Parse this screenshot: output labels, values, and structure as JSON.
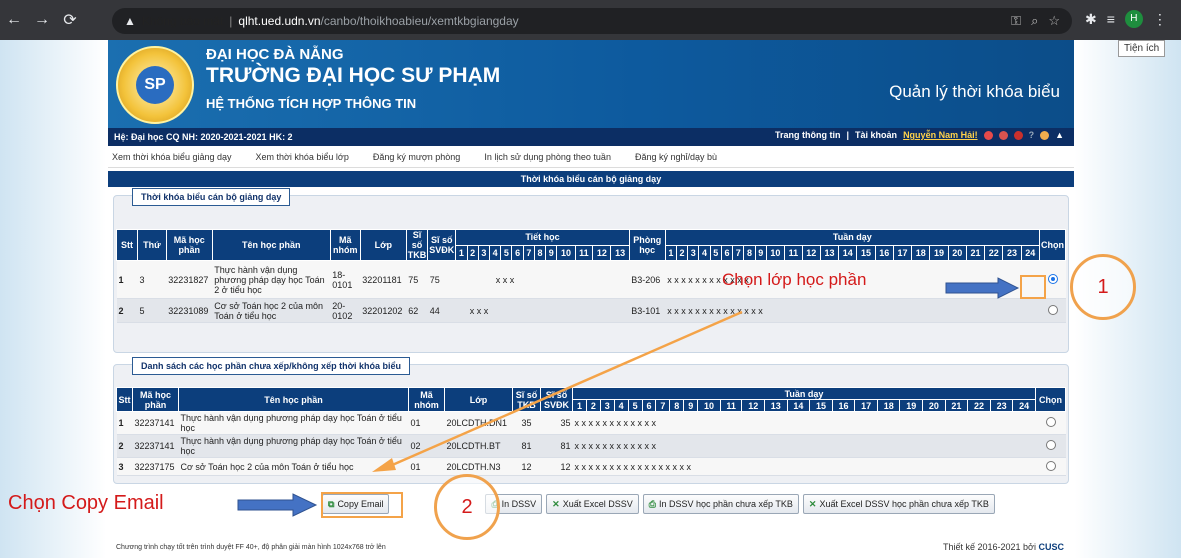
{
  "browser": {
    "security_label": "Không bảo mật",
    "url_host": "qlht.ued.udn.vn",
    "url_path": "/canbo/thoikhoabieu/xemtkbgiangday",
    "avatar_letter": "H",
    "tooltip": "Tiện ích"
  },
  "header": {
    "line1": "ĐẠI HỌC ĐÀ NẴNG",
    "line2": "TRƯỜNG ĐẠI HỌC SƯ PHẠM",
    "line3": "HỆ THỐNG TÍCH HỢP THÔNG TIN",
    "app_title": "Quản lý thời khóa biểu"
  },
  "status": {
    "left": "Hệ: Đại học CQ  NH: 2020-2021-2021  HK: 2",
    "info_link": "Trang thông tin",
    "account_label": "Tài khoản",
    "account_name": "Nguyễn Nam Hải!"
  },
  "menu": [
    "Xem thời khóa biểu giảng dạy",
    "Xem thời khóa biểu lớp",
    "Đăng ký mượn phòng",
    "In lịch sử dụng phòng theo tuần",
    "Đăng ký nghỉ/dạy bù"
  ],
  "section_title": "Thời khóa biểu cán bộ giảng dạy",
  "panel1": {
    "title": "Thời khóa biểu cán bộ giảng dạy",
    "headers": {
      "stt": "Stt",
      "thu": "Thứ",
      "ma_hp": "Mã học phần",
      "ten_hp": "Tên học phần",
      "ma_nhom": "Mã nhóm",
      "lop": "Lớp",
      "si_so_tkb": "Sĩ số TKB",
      "si_so_svdk": "Sĩ số SVĐK",
      "tiet_hoc": "Tiết học",
      "phong": "Phòng học",
      "tuan_day": "Tuần dạy",
      "chon": "Chọn"
    },
    "tiet": [
      "1",
      "2",
      "3",
      "4",
      "5",
      "6",
      "7",
      "8",
      "9",
      "10",
      "11",
      "12",
      "13"
    ],
    "tuan": [
      "1",
      "2",
      "3",
      "4",
      "5",
      "6",
      "7",
      "8",
      "9",
      "10",
      "11",
      "12",
      "13",
      "14",
      "15",
      "16",
      "17",
      "18",
      "19",
      "20",
      "21",
      "22",
      "23",
      "24"
    ],
    "rows": [
      {
        "stt": "1",
        "thu": "3",
        "ma": "32231827",
        "ten": "Thực hành vận dụng phương pháp dạy học Toán 2 ở tiểu học",
        "nhom": "18-0101",
        "lop": "32201181",
        "tkb": "75",
        "svdk": "75",
        "tiet": "x x x",
        "phong": "B3-206",
        "tuan": "x x x x x x x x x x x x",
        "selected": true
      },
      {
        "stt": "2",
        "thu": "5",
        "ma": "32231089",
        "ten": "Cơ sở Toán học 2 của môn Toán ở tiểu học",
        "nhom": "20-0102",
        "lop": "32201202",
        "tkb": "62",
        "svdk": "44",
        "tiet": "x x x",
        "phong": "B3-101",
        "tuan": "x x x x x x x x x x x x x x",
        "selected": false
      }
    ]
  },
  "panel2": {
    "title": "Danh sách các học phần chưa xếp/không xếp thời khóa biểu",
    "headers": {
      "stt": "Stt",
      "ma_hp": "Mã học phần",
      "ten_hp": "Tên học phần",
      "ma_nhom": "Mã nhóm",
      "lop": "Lớp",
      "si_so_tkb": "Sĩ số TKB",
      "si_so_svdk": "Sĩ số SVĐK",
      "tuan_day": "Tuần dạy",
      "chon": "Chọn"
    },
    "rows": [
      {
        "stt": "1",
        "ma": "32237141",
        "ten": "Thực hành vận dụng phương pháp dạy học Toán ở tiểu học",
        "nhom": "01",
        "lop": "20LCDTH.DN1",
        "tkb": "35",
        "svdk": "35",
        "tuan": "x x x x x x x x x x x x"
      },
      {
        "stt": "2",
        "ma": "32237141",
        "ten": "Thực hành vận dụng phương pháp dạy học Toán ở tiểu học",
        "nhom": "02",
        "lop": "20LCDTH.BT",
        "tkb": "81",
        "svdk": "81",
        "tuan": "x x x x x x x x x x x x"
      },
      {
        "stt": "3",
        "ma": "32237175",
        "ten": "Cơ sở Toán học 2 của môn Toán ở tiểu học",
        "nhom": "01",
        "lop": "20LCDTH.N3",
        "tkb": "12",
        "svdk": "12",
        "tuan": "x x x x x x x x x x x x x x x x x"
      }
    ]
  },
  "buttons": {
    "copy_email": "Copy Email",
    "in_dssv": "In DSSV",
    "xuat_excel": "Xuất Excel DSSV",
    "in_dssv_chua_xep": "In DSSV học phần chưa xếp TKB",
    "xuat_excel_chua_xep": "Xuất Excel DSSV học phần chưa xếp TKB"
  },
  "footer": {
    "left": "Chương trình chạy tốt trên trình duyệt FF 40+, độ phân giải màn hình 1024x768 trở lên",
    "right_prefix": "Thiết kế 2016-2021 bởi",
    "right_brand": "CUSC"
  },
  "annotations": {
    "select_class": "Chọn lớp học phần",
    "copy_email": "Chọn Copy Email",
    "step1": "1",
    "step2": "2"
  },
  "colors": {
    "header_blue": "#0c3e7c",
    "annotation_red": "#d41a1a",
    "annotation_orange": "#f0a24d"
  }
}
